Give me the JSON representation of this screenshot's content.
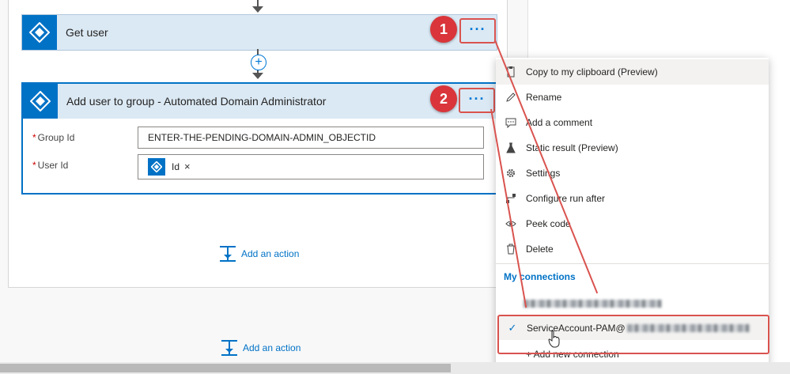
{
  "cards": {
    "get_user": {
      "title": "Get user",
      "more_label": "···"
    },
    "add_user": {
      "title": "Add user to group - Automated Domain Administrator",
      "more_label": "···",
      "fields": {
        "group_id": {
          "required_mark": "*",
          "label": "Group Id",
          "value": "ENTER-THE-PENDING-DOMAIN-ADMIN_OBJECTID"
        },
        "user_id": {
          "required_mark": "*",
          "label": "User Id",
          "token_label": "Id",
          "token_close": "×"
        }
      }
    }
  },
  "badges": {
    "one": "1",
    "two": "2"
  },
  "add_action": {
    "inner": "Add an action",
    "outer": "Add an action"
  },
  "insert_step_symbol": "+",
  "menu": {
    "items": [
      {
        "label": "Copy to my clipboard (Preview)",
        "icon": "clipboard-icon"
      },
      {
        "label": "Rename",
        "icon": "pencil-icon"
      },
      {
        "label": "Add a comment",
        "icon": "comment-icon"
      },
      {
        "label": "Static result (Preview)",
        "icon": "flask-icon"
      },
      {
        "label": "Settings",
        "icon": "gear-icon"
      },
      {
        "label": "Configure run after",
        "icon": "run-after-icon"
      },
      {
        "label": "Peek code",
        "icon": "eye-icon"
      },
      {
        "label": "Delete",
        "icon": "trash-icon"
      }
    ],
    "connections_header": "My connections",
    "selected_connection": "ServiceAccount-PAM@",
    "check_mark": "✓",
    "add_new_connection": "+ Add new connection"
  },
  "colors": {
    "accent": "#0072c6",
    "annotation_red": "#d9534f",
    "card_header": "#dbe9f4"
  }
}
